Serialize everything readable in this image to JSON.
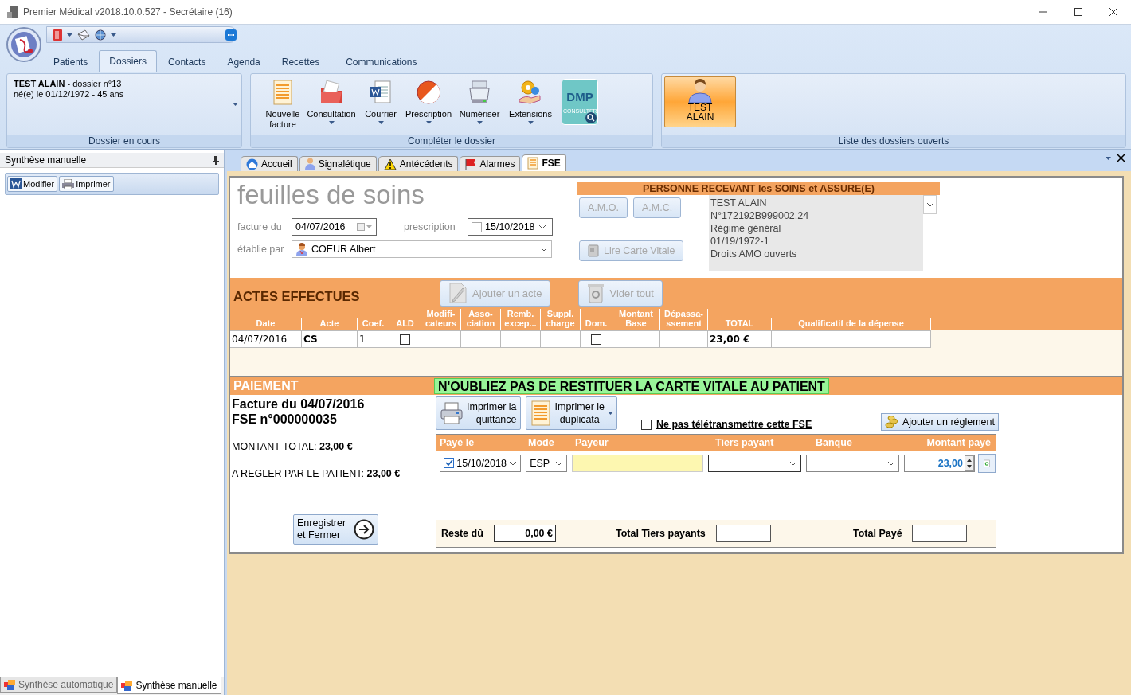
{
  "window": {
    "title": "Premier Médical v2018.10.0.527 - Secrétaire  (16)"
  },
  "ribbon": {
    "tabs": [
      {
        "label": "Patients",
        "selected": false
      },
      {
        "label": "Dossiers",
        "selected": true
      },
      {
        "label": "Contacts",
        "selected": false
      },
      {
        "label": "Agenda",
        "selected": false
      },
      {
        "label": "Recettes",
        "selected": false
      },
      {
        "label": "Communications",
        "selected": false
      }
    ],
    "current_file": {
      "patient": "TEST ALAIN",
      "file": " - dossier n°13",
      "born": "né(e) le 01/12/1972 - 45 ans",
      "caption": "Dossier en cours"
    },
    "complete": {
      "caption": "Compléter le dossier",
      "buttons": [
        {
          "label": "Nouvelle facture",
          "menu": false
        },
        {
          "label": "Consultation",
          "menu": true
        },
        {
          "label": "Courrier",
          "menu": true
        },
        {
          "label": "Prescription",
          "menu": true
        },
        {
          "label": "Numériser",
          "menu": true
        },
        {
          "label": "Extensions",
          "menu": true
        }
      ],
      "dmp_logo": {
        "title": "DMP",
        "subtitle": "CONSULTER"
      }
    },
    "open_files": {
      "caption": "Liste des dossiers ouverts",
      "items": [
        {
          "label": "TEST ALAIN",
          "selected": true
        }
      ]
    }
  },
  "left_panel": {
    "title": "Synthèse manuelle",
    "buttons": [
      "Modifier",
      "Imprimer"
    ],
    "tabs": [
      {
        "label": "Synthèse automatique",
        "selected": false
      },
      {
        "label": "Synthèse manuelle",
        "selected": true
      }
    ]
  },
  "doc_tabs": [
    {
      "label": "Accueil",
      "selected": false
    },
    {
      "label": "Signalétique",
      "selected": false
    },
    {
      "label": "Antécédents",
      "selected": false
    },
    {
      "label": "Alarmes",
      "selected": false
    },
    {
      "label": "FSE",
      "selected": true
    }
  ],
  "fse": {
    "title": "feuilles de soins",
    "invoice_date": {
      "label": "facture du",
      "value": "04/07/2016"
    },
    "prescription": {
      "label": "prescription",
      "value": "15/10/2018",
      "checked": false
    },
    "issued_by": {
      "label": "établie par",
      "value": "COEUR Albert"
    },
    "insured": {
      "heading": "PERSONNE RECEVANT les SOINS et ASSURE(E)",
      "buttons": [
        {
          "label": "A.M.O.",
          "disabled": true
        },
        {
          "label": "A.M.C.",
          "disabled": true
        },
        {
          "label": "Lire Carte Vitale",
          "disabled": true
        }
      ],
      "lines": [
        "TEST ALAIN",
        "N°172192B999002.24",
        "Régime général",
        "01/19/1972-1",
        "Droits AMO ouverts"
      ]
    },
    "acts": {
      "heading": "ACTES EFFECTUES",
      "buttons": [
        {
          "label": "Ajouter un acte",
          "disabled": true
        },
        {
          "label": "Vider tout",
          "disabled": true
        }
      ],
      "columns": [
        "Date",
        "Acte",
        "Coef.",
        "ALD",
        "Modifi-\ncateurs",
        "Asso-\nciation",
        "Remb.\nexcep...",
        "Suppl.\ncharge",
        "Dom.",
        "Montant\nBase",
        "Dépassa-\nssement",
        "TOTAL",
        "Qualificatif de la dépense"
      ],
      "rows": [
        {
          "cells": [
            {
              "kind": "text",
              "text": "04/07/2016"
            },
            {
              "kind": "strong",
              "text": "CS"
            },
            {
              "kind": "text",
              "text": "1"
            },
            {
              "kind": "check",
              "checked": false
            },
            {
              "kind": "empty"
            },
            {
              "kind": "empty"
            },
            {
              "kind": "empty"
            },
            {
              "kind": "empty"
            },
            {
              "kind": "check",
              "checked": false
            },
            {
              "kind": "empty"
            },
            {
              "kind": "empty"
            },
            {
              "kind": "strong",
              "text": "23,00 €"
            },
            {
              "kind": "empty"
            }
          ]
        }
      ]
    },
    "payment": {
      "heading": "PAIEMENT",
      "warning": "N'OUBLIEZ PAS DE RESTITUER LA CARTE VITALE AU PATIENT",
      "invoice": "Facture du 04/07/2016",
      "fse_number": "FSE n°000000035",
      "total": {
        "label": "MONTANT TOTAL: ",
        "value": "23,00 €"
      },
      "patient_due": {
        "label": "A REGLER PAR LE PATIENT: ",
        "value": "23,00 €"
      },
      "save_button": "Enregistrer\net Fermer",
      "print_receipt": "Imprimer la\nquittance",
      "print_duplicate": {
        "label": "Imprimer le\nduplicata",
        "menu": true
      },
      "no_transmit": {
        "label": "Ne pas télétransmettre cette FSE",
        "checked": false
      },
      "add_payment": "Ajouter un réglement",
      "columns": [
        "Payé le",
        "Mode",
        "Payeur",
        "Tiers payant",
        "Banque",
        "Montant payé"
      ],
      "rows": [
        {
          "cells": [
            {
              "kind": "date",
              "checked": true,
              "value": "15/10/2018"
            },
            {
              "kind": "select",
              "value": "ESP"
            },
            {
              "kind": "input"
            },
            {
              "kind": "select"
            },
            {
              "kind": "select"
            },
            {
              "kind": "spin",
              "value": "23,00"
            }
          ]
        }
      ],
      "remaining": {
        "label": "Reste dû",
        "value": "0,00 €"
      },
      "third_party_total": {
        "label": "Total Tiers payants"
      },
      "paid_total": {
        "label": "Total Payé"
      }
    }
  }
}
